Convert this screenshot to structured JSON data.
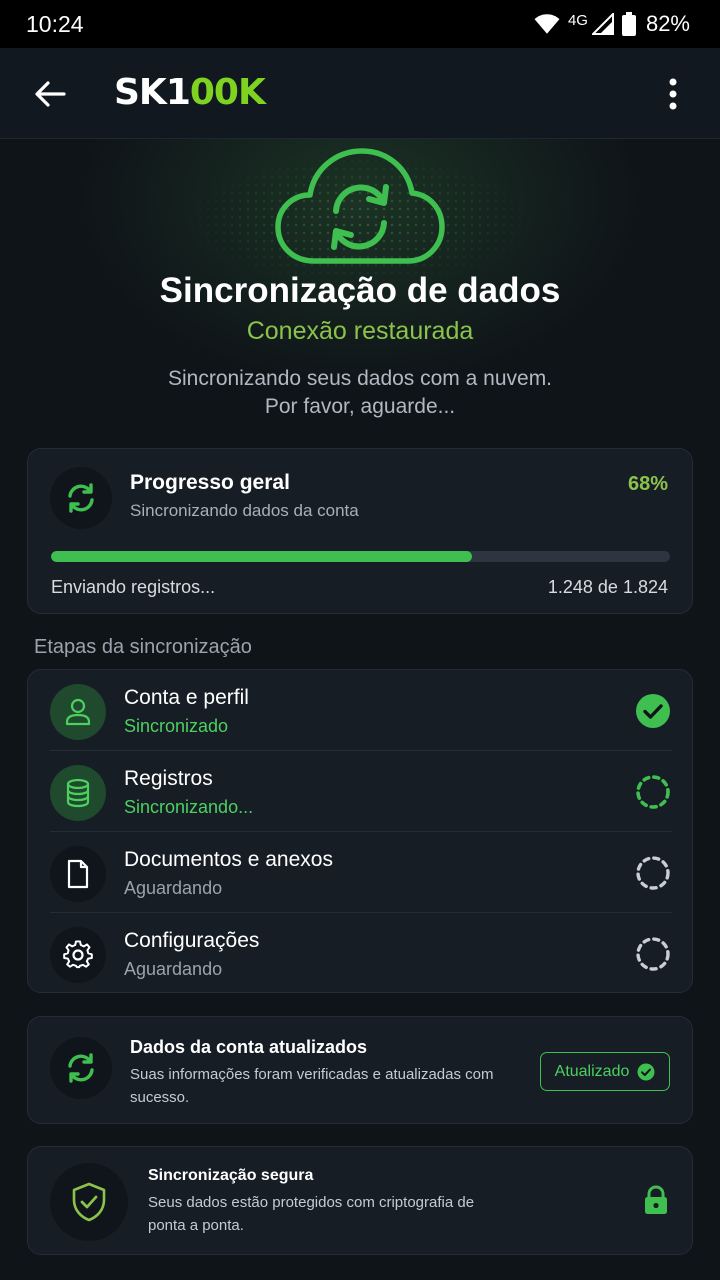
{
  "status_bar": {
    "time": "10:24",
    "network": "4G",
    "battery": "82%"
  },
  "app_bar": {
    "logo_part1": "SK1",
    "logo_part2": "00K"
  },
  "hero": {
    "title": "Sincronização de dados",
    "subtitle": "Conexão restaurada",
    "description_line1": "Sincronizando seus dados com a nuvem.",
    "description_line2": "Por favor, aguarde..."
  },
  "progress": {
    "title": "Progresso geral",
    "subtitle": "Sincronizando dados da conta",
    "percent_label": "68%",
    "percent_value": 0.68,
    "status": "Enviando registros...",
    "count": "1.248 de 1.824"
  },
  "steps_section_label": "Etapas da sincronização",
  "steps": [
    {
      "title": "Conta e perfil",
      "status": "Sincronizado",
      "state": "done",
      "icon": "user-icon"
    },
    {
      "title": "Registros",
      "status": "Sincronizando...",
      "state": "in-progress",
      "icon": "database-icon"
    },
    {
      "title": "Documentos e anexos",
      "status": "Aguardando",
      "state": "waiting",
      "icon": "document-icon"
    },
    {
      "title": "Configurações",
      "status": "Aguardando",
      "state": "waiting",
      "icon": "gear-icon"
    }
  ],
  "account_updated": {
    "title": "Dados da conta atualizados",
    "description": "Suas informações foram verificadas e atualizadas com sucesso.",
    "badge": "Atualizado"
  },
  "secure_sync": {
    "title": "Sincronização segura",
    "description": "Seus dados estão protegidos com criptografia de ponta a ponta."
  },
  "colors": {
    "accent_green": "#3fbf4f",
    "light_green": "#8bc34a",
    "background": "#0f1419",
    "card": "#161d25"
  }
}
